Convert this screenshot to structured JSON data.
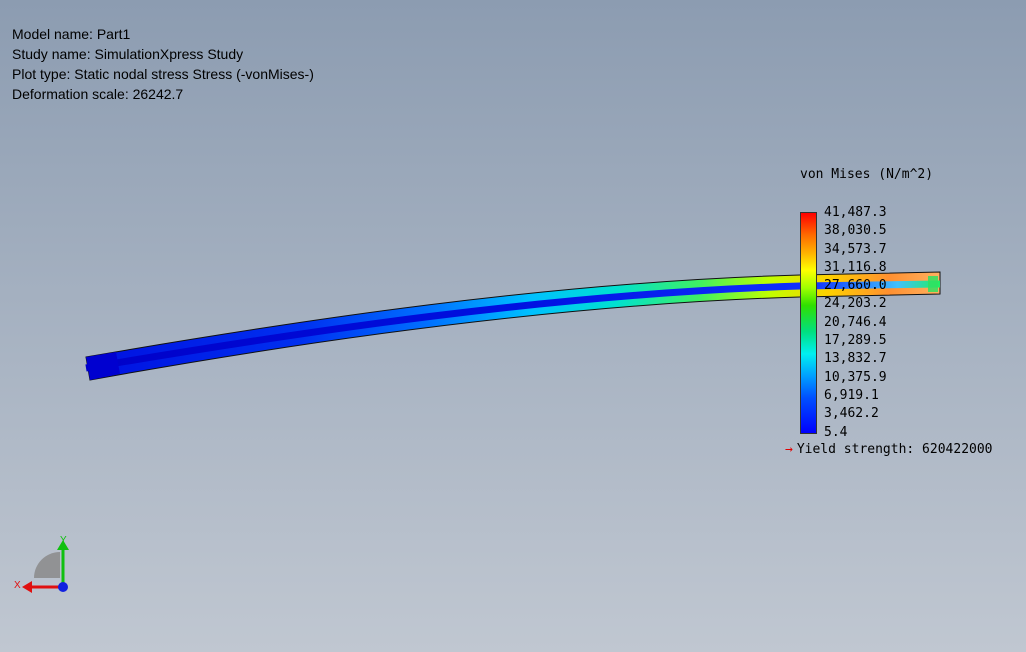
{
  "info": {
    "model_name": "Model name: Part1",
    "study_name": "Study name: SimulationXpress Study",
    "plot_type": "Plot type: Static nodal stress Stress (-vonMises-)",
    "deformation_scale": "Deformation scale: 26242.7"
  },
  "legend": {
    "title": "von Mises (N/m^2)",
    "labels": [
      "41,487.3",
      "38,030.5",
      "34,573.7",
      "31,116.8",
      "27,660.0",
      "24,203.2",
      "20,746.4",
      "17,289.5",
      "13,832.7",
      "10,375.9",
      "6,919.1",
      "3,462.2",
      "5.4"
    ],
    "yield_text": "Yield strength: 620422000",
    "colors": {
      "max": "#ff0000",
      "min": "#0000ff"
    }
  },
  "triad": {
    "x_label": "X",
    "y_label": "Y"
  }
}
